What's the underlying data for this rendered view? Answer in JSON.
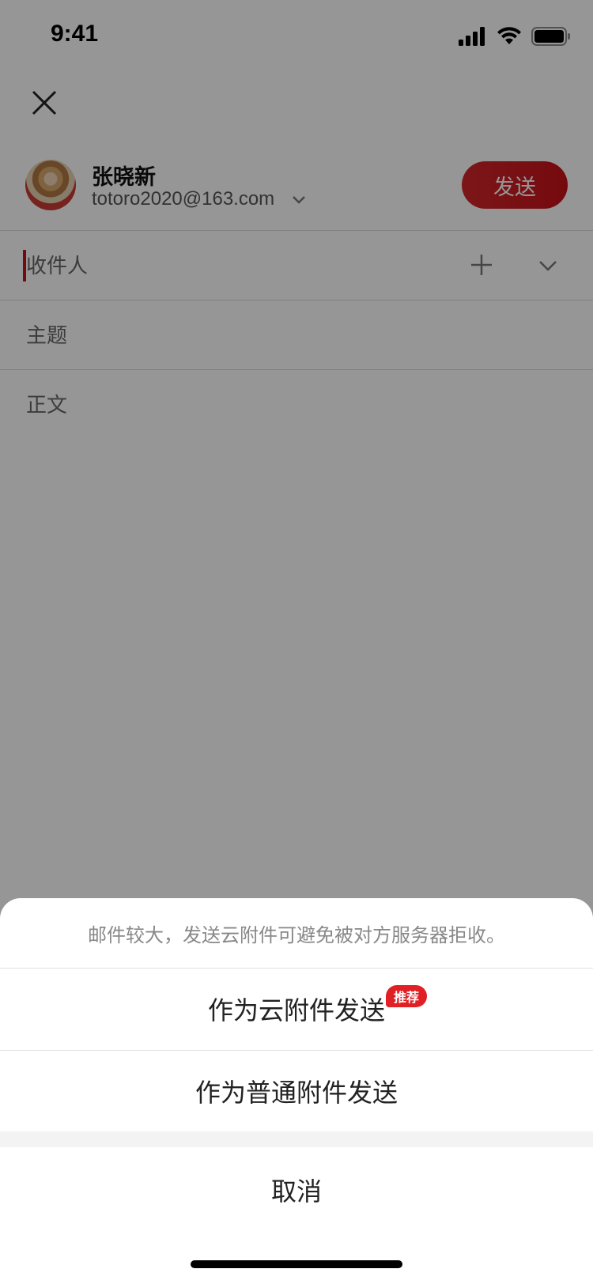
{
  "status_bar": {
    "time": "9:41"
  },
  "compose": {
    "sender_name": "张晓新",
    "sender_email": "totoro2020@163.com",
    "send_label": "发送",
    "to_placeholder": "收件人",
    "subject_placeholder": "主题",
    "body_placeholder": "正文"
  },
  "sheet": {
    "tip": "邮件较大，发送云附件可避免被对方服务器拒收。",
    "cloud_option": "作为云附件发送",
    "badge": "推荐",
    "normal_option": "作为普通附件发送",
    "cancel": "取消"
  },
  "colors": {
    "accent": "#c81218",
    "badge": "#e02024",
    "overlay": "rgba(0,0,0,0.41)"
  },
  "icons": [
    "signal-icon",
    "wifi-icon",
    "battery-icon",
    "close-icon",
    "chevron-down-icon",
    "plus-icon"
  ]
}
